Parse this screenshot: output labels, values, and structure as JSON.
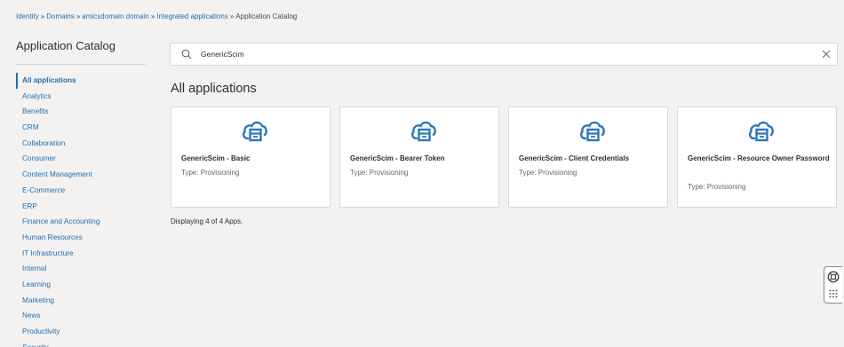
{
  "breadcrumb": {
    "items": [
      "Identity",
      "Domains",
      "amicsdomain domain",
      "Integrated applications"
    ],
    "separator": "»",
    "current": "Application Catalog"
  },
  "sidebar": {
    "title": "Application Catalog",
    "items": [
      "All applications",
      "Analytics",
      "Benefits",
      "CRM",
      "Collaboration",
      "Consumer",
      "Content Management",
      "E-Commerce",
      "ERP",
      "Finance and Accounting",
      "Human Resources",
      "IT Infrastructure",
      "Internal",
      "Learning",
      "Marketing",
      "News",
      "Productivity",
      "Security"
    ],
    "active_index": 0
  },
  "search": {
    "value": "GenericScim",
    "icon": "search-icon",
    "clear_icon": "close-icon"
  },
  "main": {
    "title": "All applications",
    "cards": [
      {
        "name": "GenericScim - Basic",
        "type": "Type: Provisioning"
      },
      {
        "name": "GenericScim - Bearer Token",
        "type": "Type: Provisioning"
      },
      {
        "name": "GenericScim - Client Credentials",
        "type": "Type: Provisioning"
      },
      {
        "name": "GenericScim - Resource Owner Password",
        "type": "Type: Provisioning"
      }
    ],
    "count_text": "Displaying 4 of 4 Apps."
  },
  "help_widget": {
    "icons": [
      "lifebuoy-icon",
      "grid-icon"
    ]
  },
  "colors": {
    "link": "#1f6fb2",
    "app_icon": "#2f76b8",
    "background": "#f3f2f1",
    "text": "#312d2a"
  }
}
